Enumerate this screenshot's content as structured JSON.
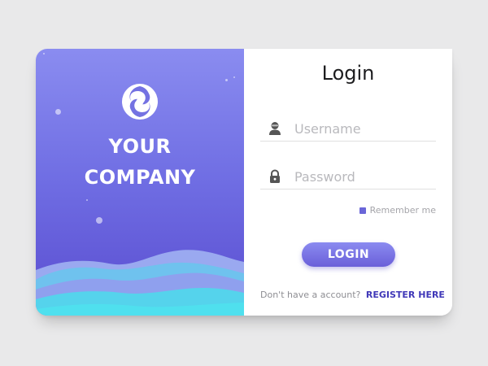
{
  "brand": {
    "line1": "YOUR",
    "line2": "COMPANY",
    "logo_icon": "swirl-icon"
  },
  "form": {
    "title": "Login",
    "username": {
      "placeholder": "Username",
      "value": "",
      "icon": "user-icon"
    },
    "password": {
      "placeholder": "Password",
      "value": "",
      "icon": "lock-icon"
    },
    "remember_label": "Remember me",
    "login_label": "LOGIN",
    "register_prompt": "Don't have a account?",
    "register_link": "REGISTER HERE"
  },
  "colors": {
    "accent": "#6a66d8",
    "link": "#4038b8",
    "panel_top": "#8a8cf0",
    "panel_bottom": "#5a4dd0",
    "wave": "#4fd6e8"
  }
}
